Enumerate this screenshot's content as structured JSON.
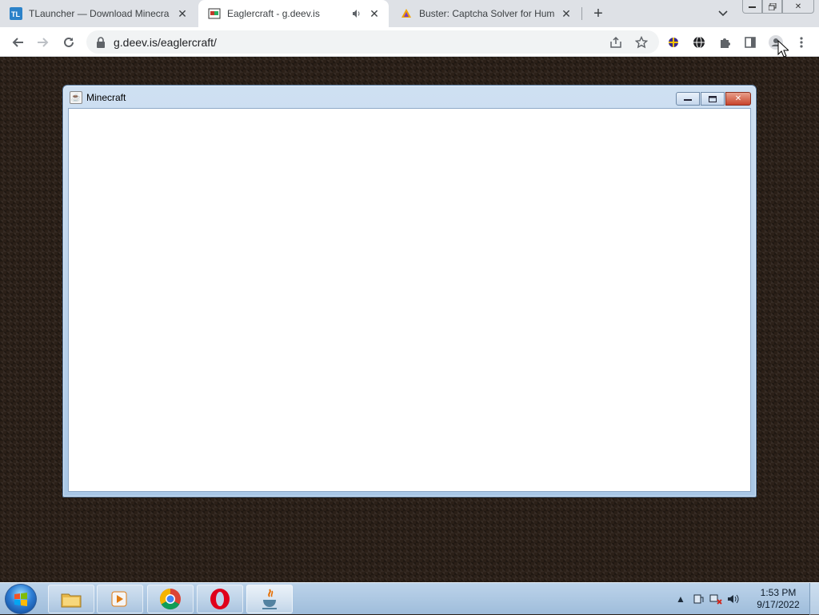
{
  "browser": {
    "tabs": [
      {
        "favicon": "tlauncher-icon",
        "title": "TLauncher — Download Minecra",
        "active": false
      },
      {
        "favicon": "eaglercraft-icon",
        "title": "Eaglercraft - g.deev.is",
        "active": true,
        "audio": true
      },
      {
        "favicon": "buster-icon",
        "title": "Buster: Captcha Solver for Huma",
        "active": false
      }
    ],
    "new_tab": "+",
    "url": "g.deev.is/eaglercraft/",
    "colors": {
      "tabstrip": "#dee1e6",
      "active_tab": "#ffffff",
      "omnibox": "#f1f3f4"
    }
  },
  "minecraft_window": {
    "title": "Minecraft",
    "controls": [
      "minimize",
      "maximize",
      "close"
    ]
  },
  "taskbar": {
    "items": [
      {
        "name": "file-explorer-icon"
      },
      {
        "name": "media-player-icon"
      },
      {
        "name": "chrome-icon"
      },
      {
        "name": "opera-icon"
      },
      {
        "name": "java-icon",
        "active": true
      }
    ],
    "clock_time": "1:53 PM",
    "clock_date": "9/17/2022"
  }
}
